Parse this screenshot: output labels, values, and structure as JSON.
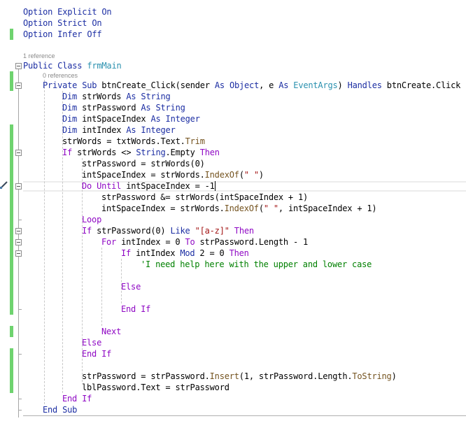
{
  "editor": {
    "language": "Visual Basic",
    "codelens": {
      "class_refs": "1 reference",
      "sub_refs": "0 references"
    },
    "lines": [
      {
        "indent": 0,
        "tokens": [
          [
            "kw",
            "Option Explicit On"
          ]
        ]
      },
      {
        "indent": 0,
        "tokens": [
          [
            "kw",
            "Option Strict On"
          ]
        ]
      },
      {
        "indent": 0,
        "tokens": [
          [
            "kw",
            "Option Infer Off"
          ]
        ]
      },
      {
        "indent": 0,
        "tokens": []
      },
      {
        "indent": 0,
        "tokens": [
          [
            "kw",
            "Public Class "
          ],
          [
            "ty",
            "frmMain"
          ]
        ]
      },
      {
        "indent": 1,
        "tokens": [
          [
            "kw",
            "Private Sub "
          ],
          [
            "",
            "btnCreate_Click(sender "
          ],
          [
            "kw",
            "As Object"
          ],
          [
            "",
            ", e "
          ],
          [
            "kw",
            "As "
          ],
          [
            "ty",
            "EventArgs"
          ],
          [
            "",
            ") "
          ],
          [
            "kw",
            "Handles "
          ],
          [
            "",
            "btnCreate.Click"
          ]
        ]
      },
      {
        "indent": 2,
        "tokens": [
          [
            "kw",
            "Dim "
          ],
          [
            "",
            "strWords "
          ],
          [
            "kw",
            "As String"
          ]
        ]
      },
      {
        "indent": 2,
        "tokens": [
          [
            "kw",
            "Dim "
          ],
          [
            "",
            "strPassword "
          ],
          [
            "kw",
            "As String"
          ]
        ]
      },
      {
        "indent": 2,
        "tokens": [
          [
            "kw",
            "Dim "
          ],
          [
            "",
            "intSpaceIndex "
          ],
          [
            "kw",
            "As Integer"
          ]
        ]
      },
      {
        "indent": 2,
        "tokens": [
          [
            "kw",
            "Dim "
          ],
          [
            "",
            "intIndex "
          ],
          [
            "kw",
            "As Integer"
          ]
        ]
      },
      {
        "indent": 2,
        "tokens": [
          [
            "",
            "strWords = txtWords.Text."
          ],
          [
            "mt",
            "Trim"
          ]
        ]
      },
      {
        "indent": 2,
        "tokens": [
          [
            "kwp",
            "If "
          ],
          [
            "",
            "strWords <> "
          ],
          [
            "kw",
            "String"
          ],
          [
            "",
            ".Empty "
          ],
          [
            "kwp",
            "Then"
          ]
        ]
      },
      {
        "indent": 3,
        "tokens": [
          [
            "",
            "strPassword = strWords(0)"
          ]
        ]
      },
      {
        "indent": 3,
        "tokens": [
          [
            "",
            "intSpaceIndex = strWords."
          ],
          [
            "mt",
            "IndexOf"
          ],
          [
            "",
            "("
          ],
          [
            "str",
            "\" \""
          ],
          [
            "",
            ")"
          ]
        ]
      },
      {
        "indent": 3,
        "tokens": [
          [
            "kwp",
            "Do Until "
          ],
          [
            "",
            "intSpaceIndex = -1"
          ]
        ]
      },
      {
        "indent": 4,
        "tokens": [
          [
            "",
            "strPassword &= strWords(intSpaceIndex + 1)"
          ]
        ]
      },
      {
        "indent": 4,
        "tokens": [
          [
            "",
            "intSpaceIndex = strWords."
          ],
          [
            "mt",
            "IndexOf"
          ],
          [
            "",
            "("
          ],
          [
            "str",
            "\" \""
          ],
          [
            "",
            ", intSpaceIndex + 1)"
          ]
        ]
      },
      {
        "indent": 3,
        "tokens": [
          [
            "kwp",
            "Loop"
          ]
        ]
      },
      {
        "indent": 3,
        "tokens": [
          [
            "kwp",
            "If "
          ],
          [
            "",
            "strPassword(0) "
          ],
          [
            "kw",
            "Like "
          ],
          [
            "str",
            "\"[a-z]\""
          ],
          [
            "kwp",
            " Then"
          ]
        ]
      },
      {
        "indent": 4,
        "tokens": [
          [
            "kwp",
            "For "
          ],
          [
            "",
            "intIndex = 0 "
          ],
          [
            "kwp",
            "To "
          ],
          [
            "",
            "strPassword.Length - 1"
          ]
        ]
      },
      {
        "indent": 5,
        "tokens": [
          [
            "kwp",
            "If "
          ],
          [
            "",
            "intIndex "
          ],
          [
            "kw",
            "Mod "
          ],
          [
            "",
            "2 = 0 "
          ],
          [
            "kwp",
            "Then"
          ]
        ]
      },
      {
        "indent": 6,
        "tokens": [
          [
            "cm",
            "'I need help here with the upper and lower case"
          ]
        ]
      },
      {
        "indent": 6,
        "tokens": []
      },
      {
        "indent": 5,
        "tokens": [
          [
            "kwp",
            "Else"
          ]
        ]
      },
      {
        "indent": 6,
        "tokens": []
      },
      {
        "indent": 5,
        "tokens": [
          [
            "kwp",
            "End If"
          ]
        ]
      },
      {
        "indent": 5,
        "tokens": []
      },
      {
        "indent": 4,
        "tokens": [
          [
            "kwp",
            "Next"
          ]
        ]
      },
      {
        "indent": 3,
        "tokens": [
          [
            "kwp",
            "Else"
          ]
        ]
      },
      {
        "indent": 3,
        "tokens": [
          [
            "kwp",
            "End If"
          ]
        ]
      },
      {
        "indent": 3,
        "tokens": []
      },
      {
        "indent": 3,
        "tokens": [
          [
            "",
            "strPassword = strPassword."
          ],
          [
            "mt",
            "Insert"
          ],
          [
            "",
            "(1, strPassword.Length."
          ],
          [
            "mt",
            "ToString"
          ],
          [
            "",
            ")"
          ]
        ]
      },
      {
        "indent": 3,
        "tokens": [
          [
            "",
            "lblPassword.Text = strPassword"
          ]
        ]
      },
      {
        "indent": 2,
        "tokens": [
          [
            "kwp",
            "End If"
          ]
        ]
      },
      {
        "indent": 1,
        "tokens": [
          [
            "kw",
            "End Sub"
          ]
        ]
      }
    ],
    "current_line_index": 14,
    "change_markers": [
      [
        2,
        2
      ],
      [
        5,
        5
      ],
      [
        9,
        19
      ],
      [
        20,
        25
      ],
      [
        27,
        27
      ],
      [
        29,
        32
      ]
    ],
    "fold_markers": [
      4,
      5,
      11,
      14,
      18,
      19,
      20
    ],
    "colors": {
      "keyword": "#1c2ea3",
      "control_keyword": "#8f08c4",
      "type": "#2b91af",
      "string": "#a31515",
      "comment": "#008000",
      "method": "#74531f",
      "change_bar": "#6fd36f"
    }
  }
}
